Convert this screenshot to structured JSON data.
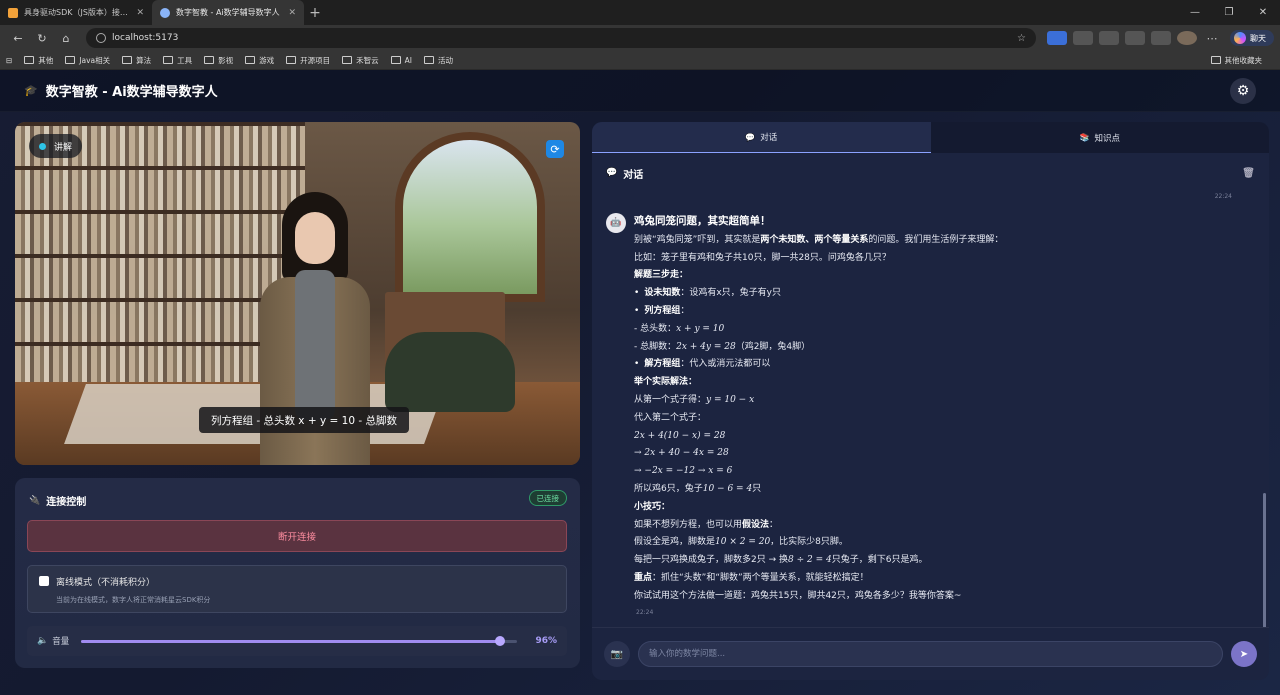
{
  "browser": {
    "tabs": [
      {
        "title": "具身驱动SDK（JS版本）接入说明",
        "active": false,
        "fav": "#f2a23a"
      },
      {
        "title": "数字智教 - Ai数学辅导数字人",
        "active": true,
        "fav": "#8ab4f8"
      }
    ],
    "url": "localhost:5173",
    "chat_label": "聊天",
    "bookmarks": [
      "其他",
      "Java相关",
      "算法",
      "工具",
      "影视",
      "游戏",
      "开源项目",
      "禾智云",
      "AI",
      "活动"
    ],
    "bookmarks_right": "其他收藏夹"
  },
  "app": {
    "title": "数字智教 - Ai数学辅导数字人"
  },
  "video": {
    "mode_label": "讲解",
    "subtitle": "列方程组 - 总头数 x + y = 10 - 总脚数"
  },
  "connection": {
    "title": "连接控制",
    "status": "已连接",
    "disconnect_label": "断开连接",
    "offline_label": "离线模式（不消耗积分）",
    "offline_hint": "当前为在线模式，数字人将正常消耗星云SDK积分",
    "volume_label": "音量",
    "volume_value": "96%",
    "volume_level": 0.96
  },
  "right_panel": {
    "tabs": [
      "对话",
      "知识点"
    ],
    "chat_title": "对话",
    "ts_top": "22:24",
    "ts_bottom": "22:24",
    "input_placeholder": "输入你的数学问题...",
    "message": {
      "heading": "鸡兔同笼问题，其实超简单！",
      "l1a": "别被“鸡兔同笼”吓到，其实就是",
      "l1b": "两个未知数、两个等量关系",
      "l1c": "的问题。我们用生活例子来理解：",
      "l2": "比如：笼子里有鸡和兔子共10只，脚一共28只。问鸡兔各几只？",
      "l3": "解题三步走：",
      "l4a": "设未知数",
      "l4b": "：设鸡有x只，兔子有y只",
      "l5a": "列方程组",
      "l5b": "：",
      "l6a": "- 总头数：",
      "l6b": "x + y = 10",
      "l7a": "- 总脚数：",
      "l7b": "2x + 4y = 28",
      "l7c": "（鸡2脚，兔4脚）",
      "l8a": "解方程组",
      "l8b": "：代入或消元法都可以",
      "l9": "举个实际解法：",
      "l10a": "从第一个式子得：",
      "l10b": "y = 10 − x",
      "l11": "代入第二个式子：",
      "l12": "2x + 4(10 − x) = 28",
      "l13": "→ 2x + 40 − 4x = 28",
      "l14": "→ −2x = −12 → x = 6",
      "l15a": "所以鸡6只，兔子",
      "l15b": "10 − 6 = 4",
      "l15c": "只",
      "l16": "小技巧：",
      "l17a": "如果不想列方程，也可以用",
      "l17b": "假设法",
      "l17c": "：",
      "l18a": "假设全是鸡，脚数是",
      "l18b": "10 × 2 = 20",
      "l18c": "，比实际少8只脚。",
      "l19a": "每把一只鸡换成兔子，脚数多2只 → 换",
      "l19b": "8 ÷ 2 = 4",
      "l19c": "只兔子，剩下6只是鸡。",
      "l20a": "重点",
      "l20b": "：抓住“头数”和“脚数”两个等量关系，就能轻松搞定！",
      "l21": "你试试用这个方法做一道题：鸡兔共15只，脚共42只，鸡兔各多少？我等你答案~"
    }
  }
}
